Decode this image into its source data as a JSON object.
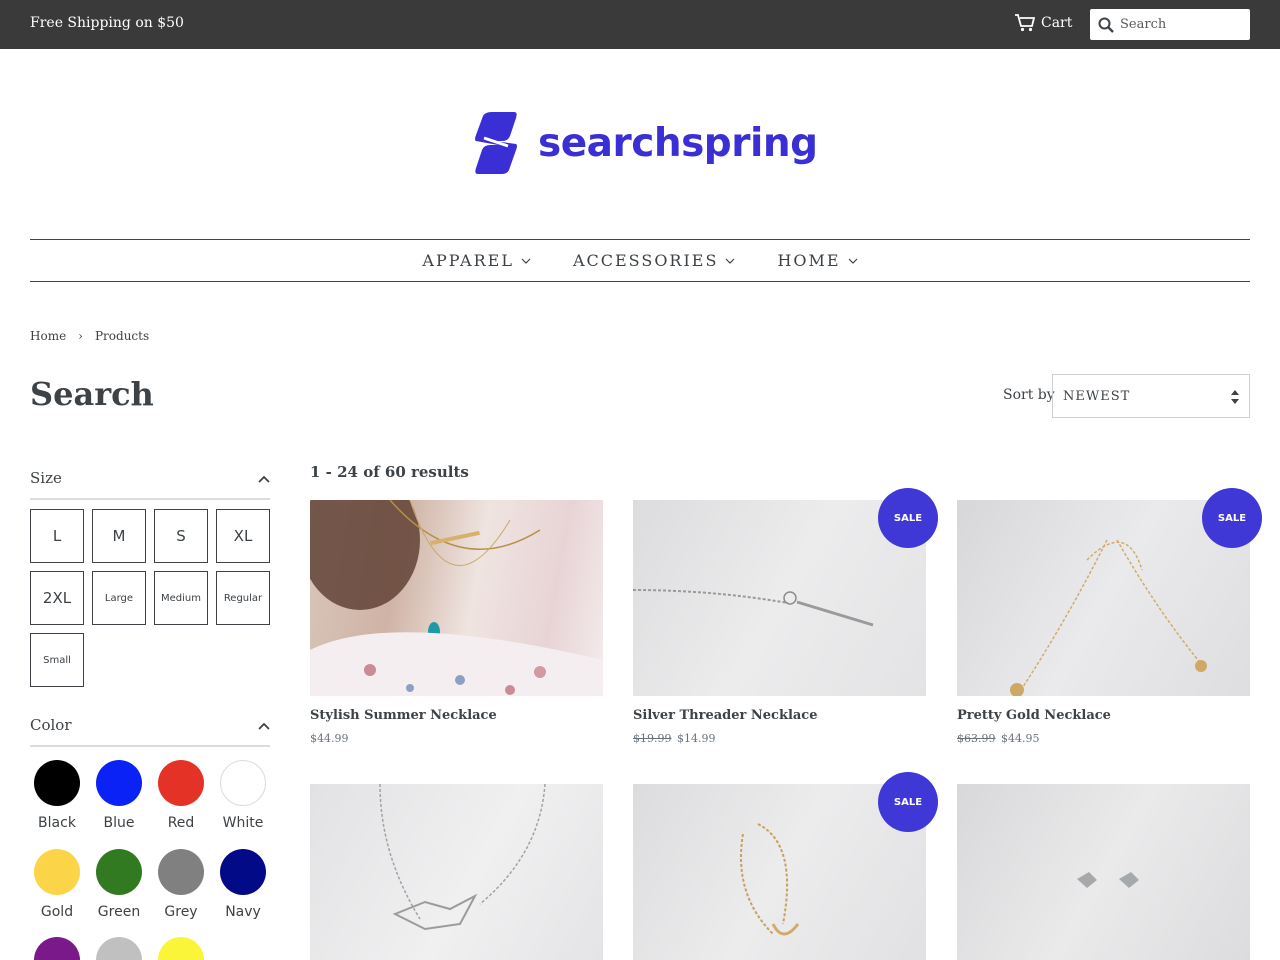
{
  "topbar": {
    "promo": "Free Shipping on $50",
    "cart_label": "Cart",
    "search_placeholder": "Search"
  },
  "logo": {
    "text": "searchspring",
    "color": "#3a2fd4"
  },
  "nav": [
    {
      "label": "APPAREL"
    },
    {
      "label": "ACCESSORIES"
    },
    {
      "label": "HOME"
    }
  ],
  "breadcrumb": {
    "home": "Home",
    "separator": "›",
    "current": "Products"
  },
  "page_title": "Search",
  "sort": {
    "label": "Sort by",
    "selected": "NEWEST"
  },
  "facets": {
    "size": {
      "title": "Size",
      "options": [
        "L",
        "M",
        "S",
        "XL",
        "2XL",
        "Large",
        "Medium",
        "Regular",
        "Small"
      ]
    },
    "color": {
      "title": "Color",
      "options": [
        {
          "label": "Black",
          "color": "#000000"
        },
        {
          "label": "Blue",
          "color": "#0a22f5"
        },
        {
          "label": "Red",
          "color": "#e53226"
        },
        {
          "label": "White",
          "color": "#ffffff"
        },
        {
          "label": "Gold",
          "color": "#fbd547"
        },
        {
          "label": "Green",
          "color": "#327a22"
        },
        {
          "label": "Grey",
          "color": "#808080"
        },
        {
          "label": "Navy",
          "color": "#020a88"
        },
        {
          "label": "",
          "color": "#7a1a8a"
        },
        {
          "label": "",
          "color": "#c0c0c0"
        },
        {
          "label": "",
          "color": "#fbf53a"
        }
      ]
    }
  },
  "results": {
    "count_text": "1 - 24 of 60 results"
  },
  "products": [
    {
      "name": "Stylish Summer Necklace",
      "price": "$44.99",
      "old_price": "",
      "sale": false
    },
    {
      "name": "Silver Threader Necklace",
      "price": "$14.99",
      "old_price": "$19.99",
      "sale": true
    },
    {
      "name": "Pretty Gold Necklace",
      "price": "$44.95",
      "old_price": "$63.99",
      "sale": true
    },
    {
      "name": "",
      "price": "",
      "old_price": "",
      "sale": false
    },
    {
      "name": "",
      "price": "",
      "old_price": "",
      "sale": true
    },
    {
      "name": "",
      "price": "",
      "old_price": "",
      "sale": false
    }
  ],
  "sale_badge": "SALE",
  "colors": {
    "topbar": "#3a3a3a",
    "accent": "#3f38d7",
    "nav_border": "#3a3f84"
  }
}
